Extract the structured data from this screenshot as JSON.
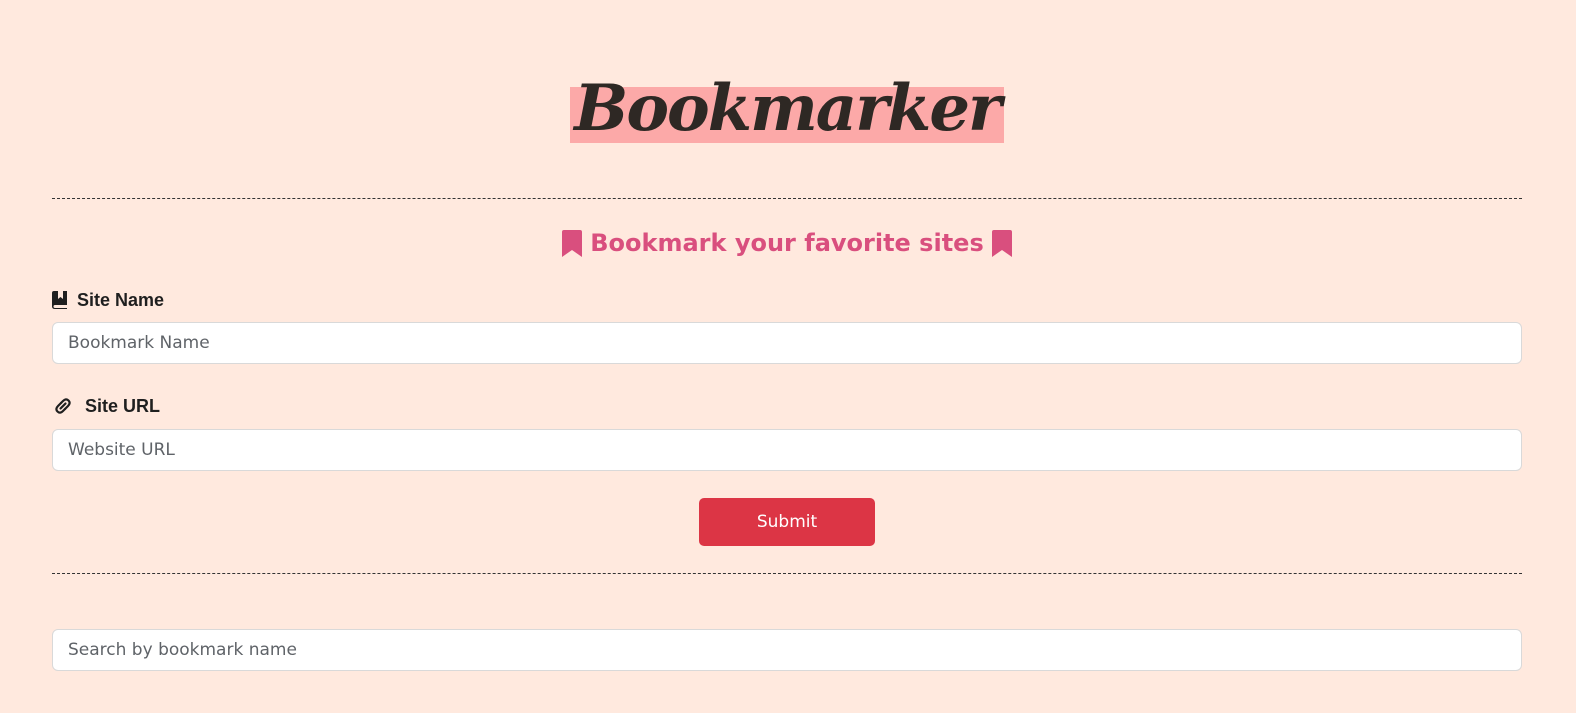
{
  "header": {
    "title": "Bookmarker"
  },
  "form": {
    "subtitle": "Bookmark your favorite sites",
    "site_name": {
      "label": "Site Name",
      "placeholder": "Bookmark Name",
      "value": ""
    },
    "site_url": {
      "label": "Site URL",
      "placeholder": "Website URL",
      "value": ""
    },
    "submit_label": "Submit"
  },
  "search": {
    "placeholder": "Search by bookmark name",
    "value": ""
  },
  "icons": {
    "subtitle_left": "bookmark-icon",
    "subtitle_right": "bookmark-icon",
    "site_name": "book-bookmark-icon",
    "site_url": "link-icon"
  },
  "colors": {
    "background": "#ffe9de",
    "title_highlight": "#fca9a8",
    "subtitle": "#d94f7e",
    "submit": "#dc3545"
  }
}
